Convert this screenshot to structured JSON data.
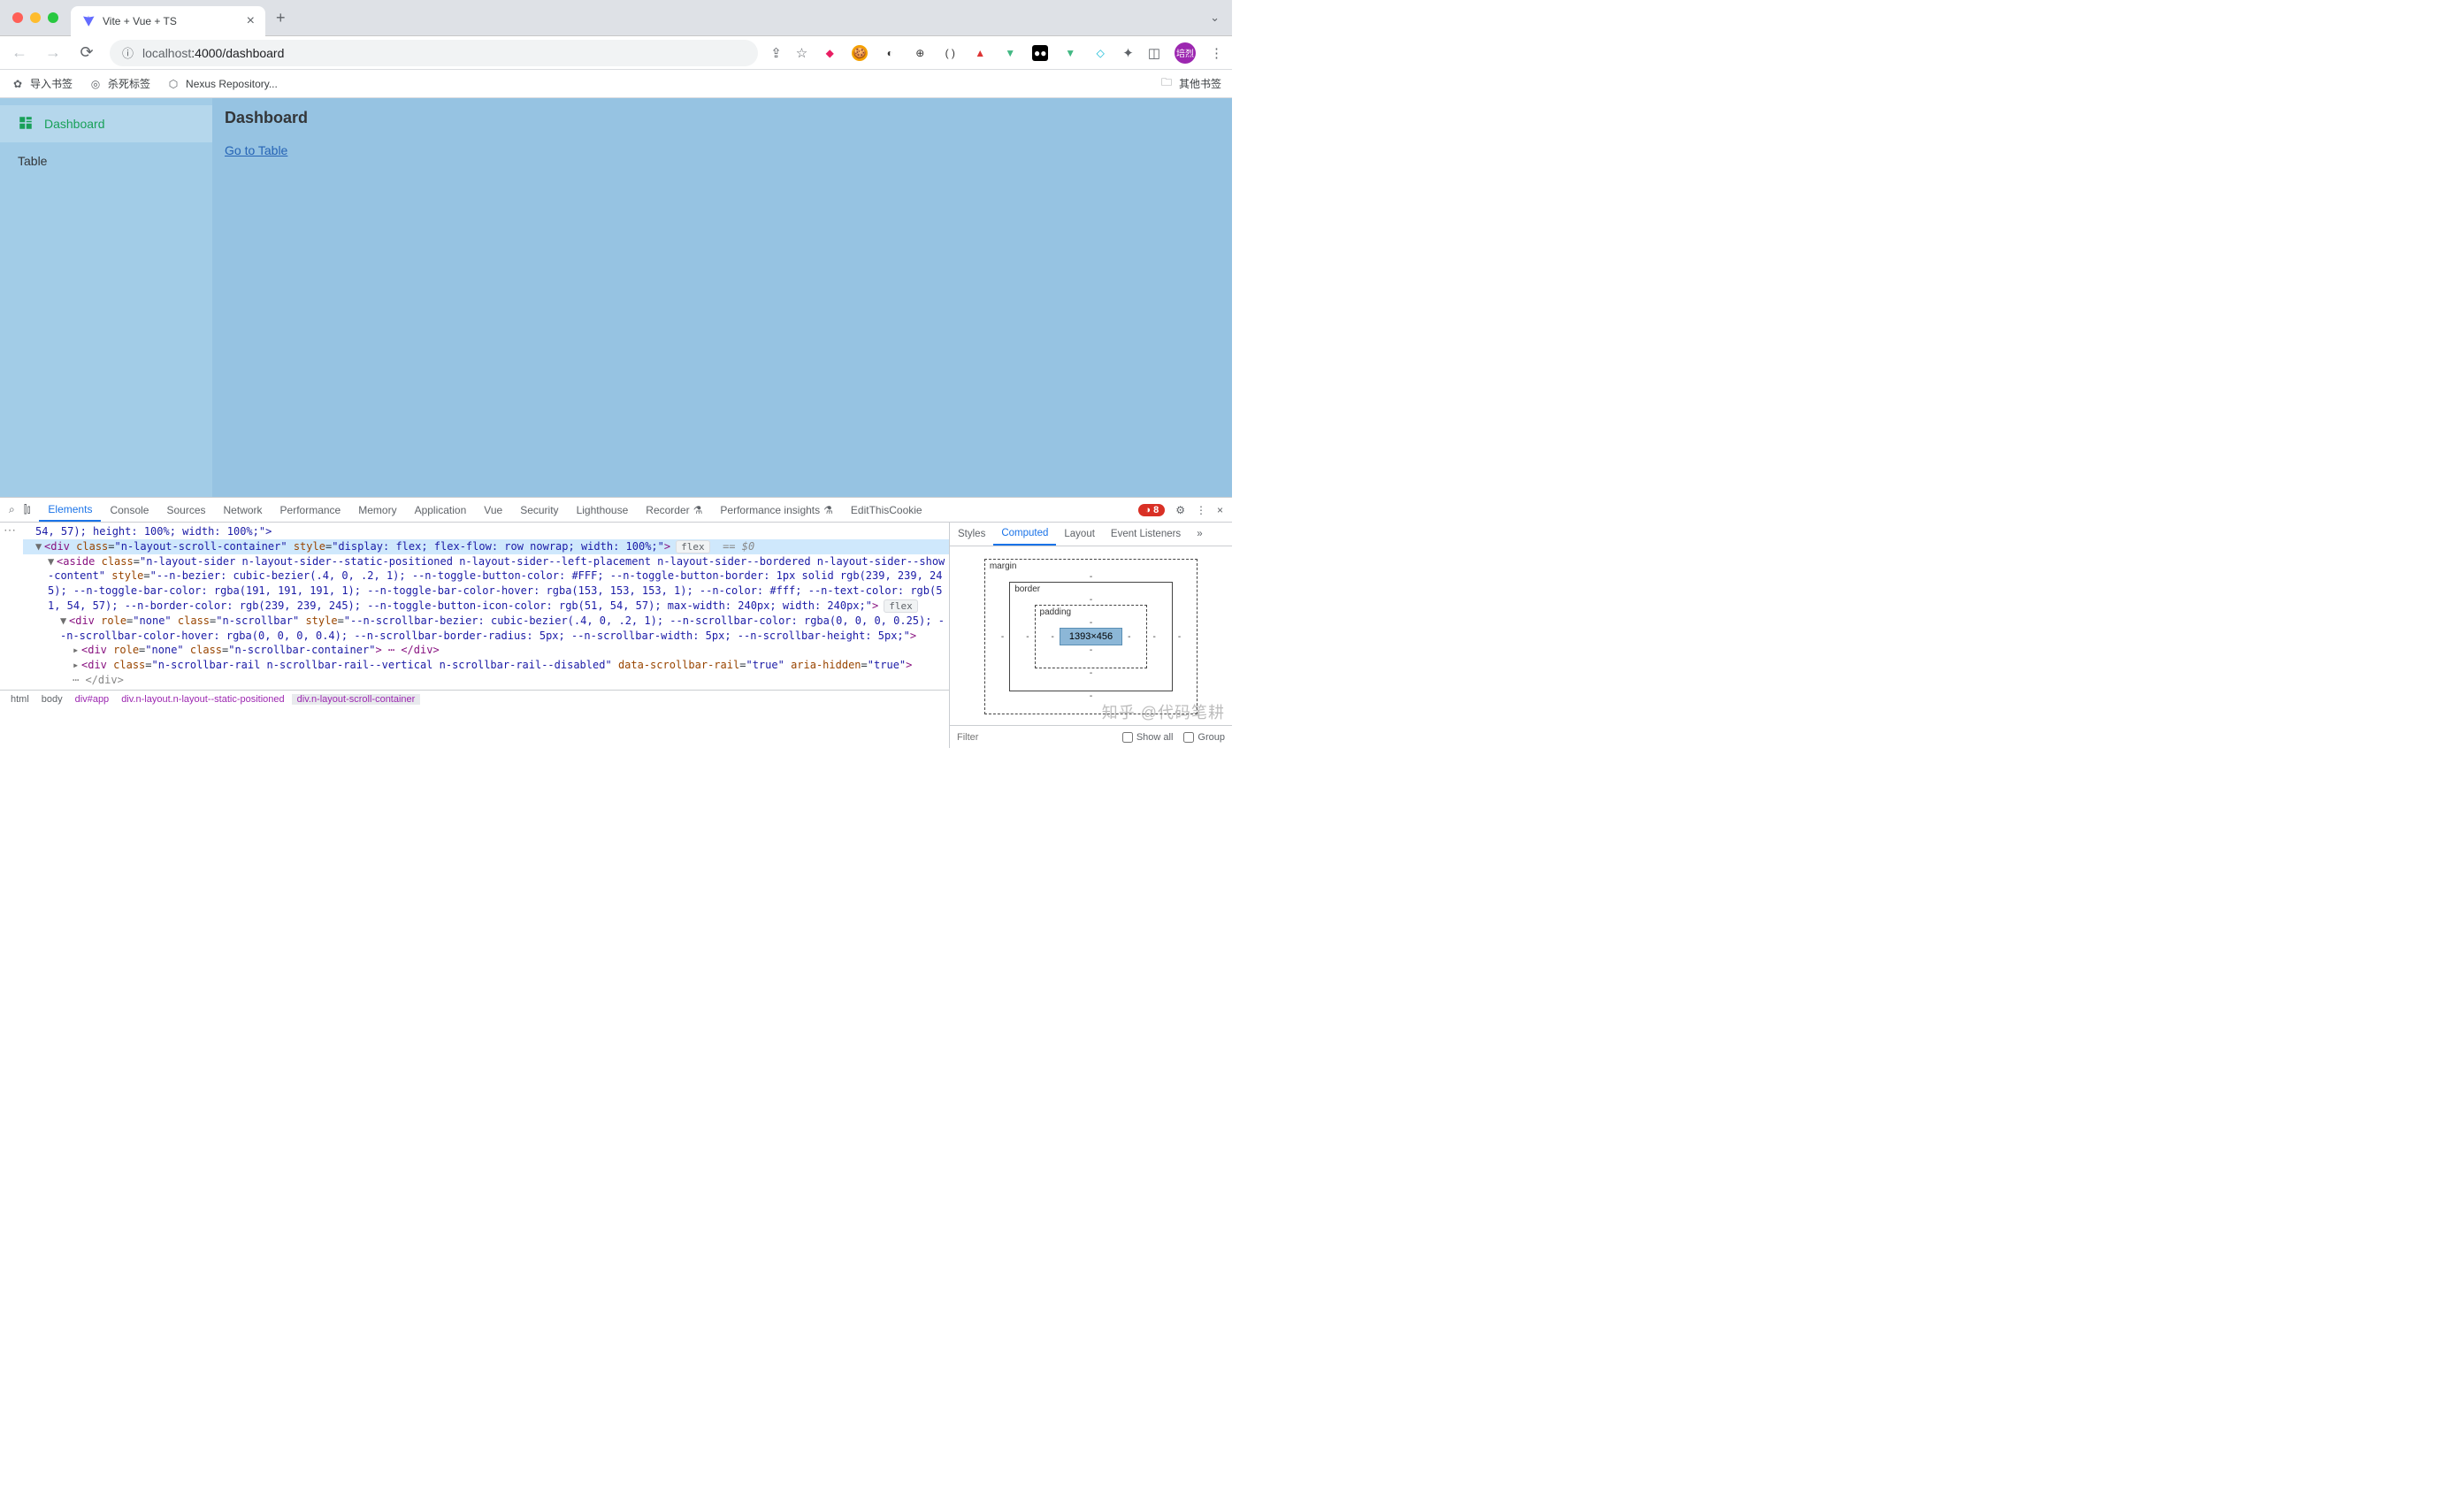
{
  "browser": {
    "tab_title": "Vite + Vue + TS",
    "url_display": "localhost:4000/dashboard",
    "url_host_dim": "localhost",
    "url_rest": ":4000/dashboard",
    "bookmarks": [
      {
        "icon": "gear",
        "label": "导入书签"
      },
      {
        "icon": "target",
        "label": "杀死标签"
      },
      {
        "icon": "hex",
        "label": "Nexus Repository..."
      }
    ],
    "other_bookmarks": "其他书签",
    "avatar_text": "培烈"
  },
  "app": {
    "sidebar": [
      {
        "icon": "dashboard",
        "label": "Dashboard",
        "active": true
      },
      {
        "icon": "",
        "label": "Table",
        "active": false
      }
    ],
    "page_title": "Dashboard",
    "page_link": "Go to Table"
  },
  "devtools": {
    "tabs": [
      "Elements",
      "Console",
      "Sources",
      "Network",
      "Performance",
      "Memory",
      "Application",
      "Vue",
      "Security",
      "Lighthouse",
      "Recorder",
      "Performance insights",
      "EditThisCookie"
    ],
    "active_tab": "Elements",
    "experiment_tabs": [
      "Recorder",
      "Performance insights"
    ],
    "error_count": "8",
    "styles_tabs": [
      "Styles",
      "Computed",
      "Layout",
      "Event Listeners"
    ],
    "styles_active": "Computed",
    "box_model": {
      "margin_label": "margin",
      "border_label": "border",
      "padding_label": "padding",
      "content": "1393×456",
      "dash": "-"
    },
    "filter_placeholder": "Filter",
    "show_all": "Show all",
    "group": "Group",
    "breadcrumb": [
      "html",
      "body",
      "div#app",
      "div.n-layout.n-layout--static-positioned",
      "div.n-layout-scroll-container"
    ],
    "dom": {
      "line0": "54, 57); height: 100%; width: 100%;\">",
      "line1_open": "<div",
      "line1_class": "n-layout-scroll-container",
      "line1_style": "display: flex; flex-flow: row nowrap; width: 100%;",
      "line1_close": ">",
      "line1_pill": "flex",
      "line1_dim": "== $0",
      "line2_open": "<aside",
      "line2_class": "n-layout-sider n-layout-sider--static-positioned n-layout-sider--left-placement n-layout-sider--bordered n-layout-sider--show-content",
      "line2_style": "--n-bezier: cubic-bezier(.4, 0, .2, 1); --n-toggle-button-color: #FFF; --n-toggle-button-border: 1px solid rgb(239, 239, 245); --n-toggle-bar-color: rgba(191, 191, 191, 1); --n-toggle-bar-color-hover: rgba(153, 153, 153, 1); --n-color: #fff; --n-text-color: rgb(51, 54, 57); --n-border-color: rgb(239, 239, 245); --n-toggle-button-icon-color: rgb(51, 54, 57); max-width: 240px; width: 240px;",
      "line2_close": ">",
      "line2_pill": "flex",
      "line3_open": "<div",
      "line3_role": "none",
      "line3_class": "n-scrollbar",
      "line3_style": "--n-scrollbar-bezier: cubic-bezier(.4, 0, .2, 1); --n-scrollbar-color: rgba(0, 0, 0, 0.25); --n-scrollbar-color-hover: rgba(0, 0, 0, 0.4); --n-scrollbar-border-radius: 5px; --n-scrollbar-width: 5px; --n-scrollbar-height: 5px;",
      "line3_close": ">",
      "line4_open": "<div",
      "line4_role": "none",
      "line4_class": "n-scrollbar-container",
      "line4_close_full": "> ⋯ </div>",
      "line5_open": "<div",
      "line5_class": "n-scrollbar-rail n-scrollbar-rail--vertical n-scrollbar-rail--disabled",
      "line5_data_attr": "data-scrollbar-rail",
      "line5_data_val": "true",
      "line5_aria_attr": "aria-hidden",
      "line5_aria_val": "true",
      "line5_close": ">",
      "line6": "⋯ </div>"
    },
    "watermark": "知乎 @代码笔耕"
  }
}
